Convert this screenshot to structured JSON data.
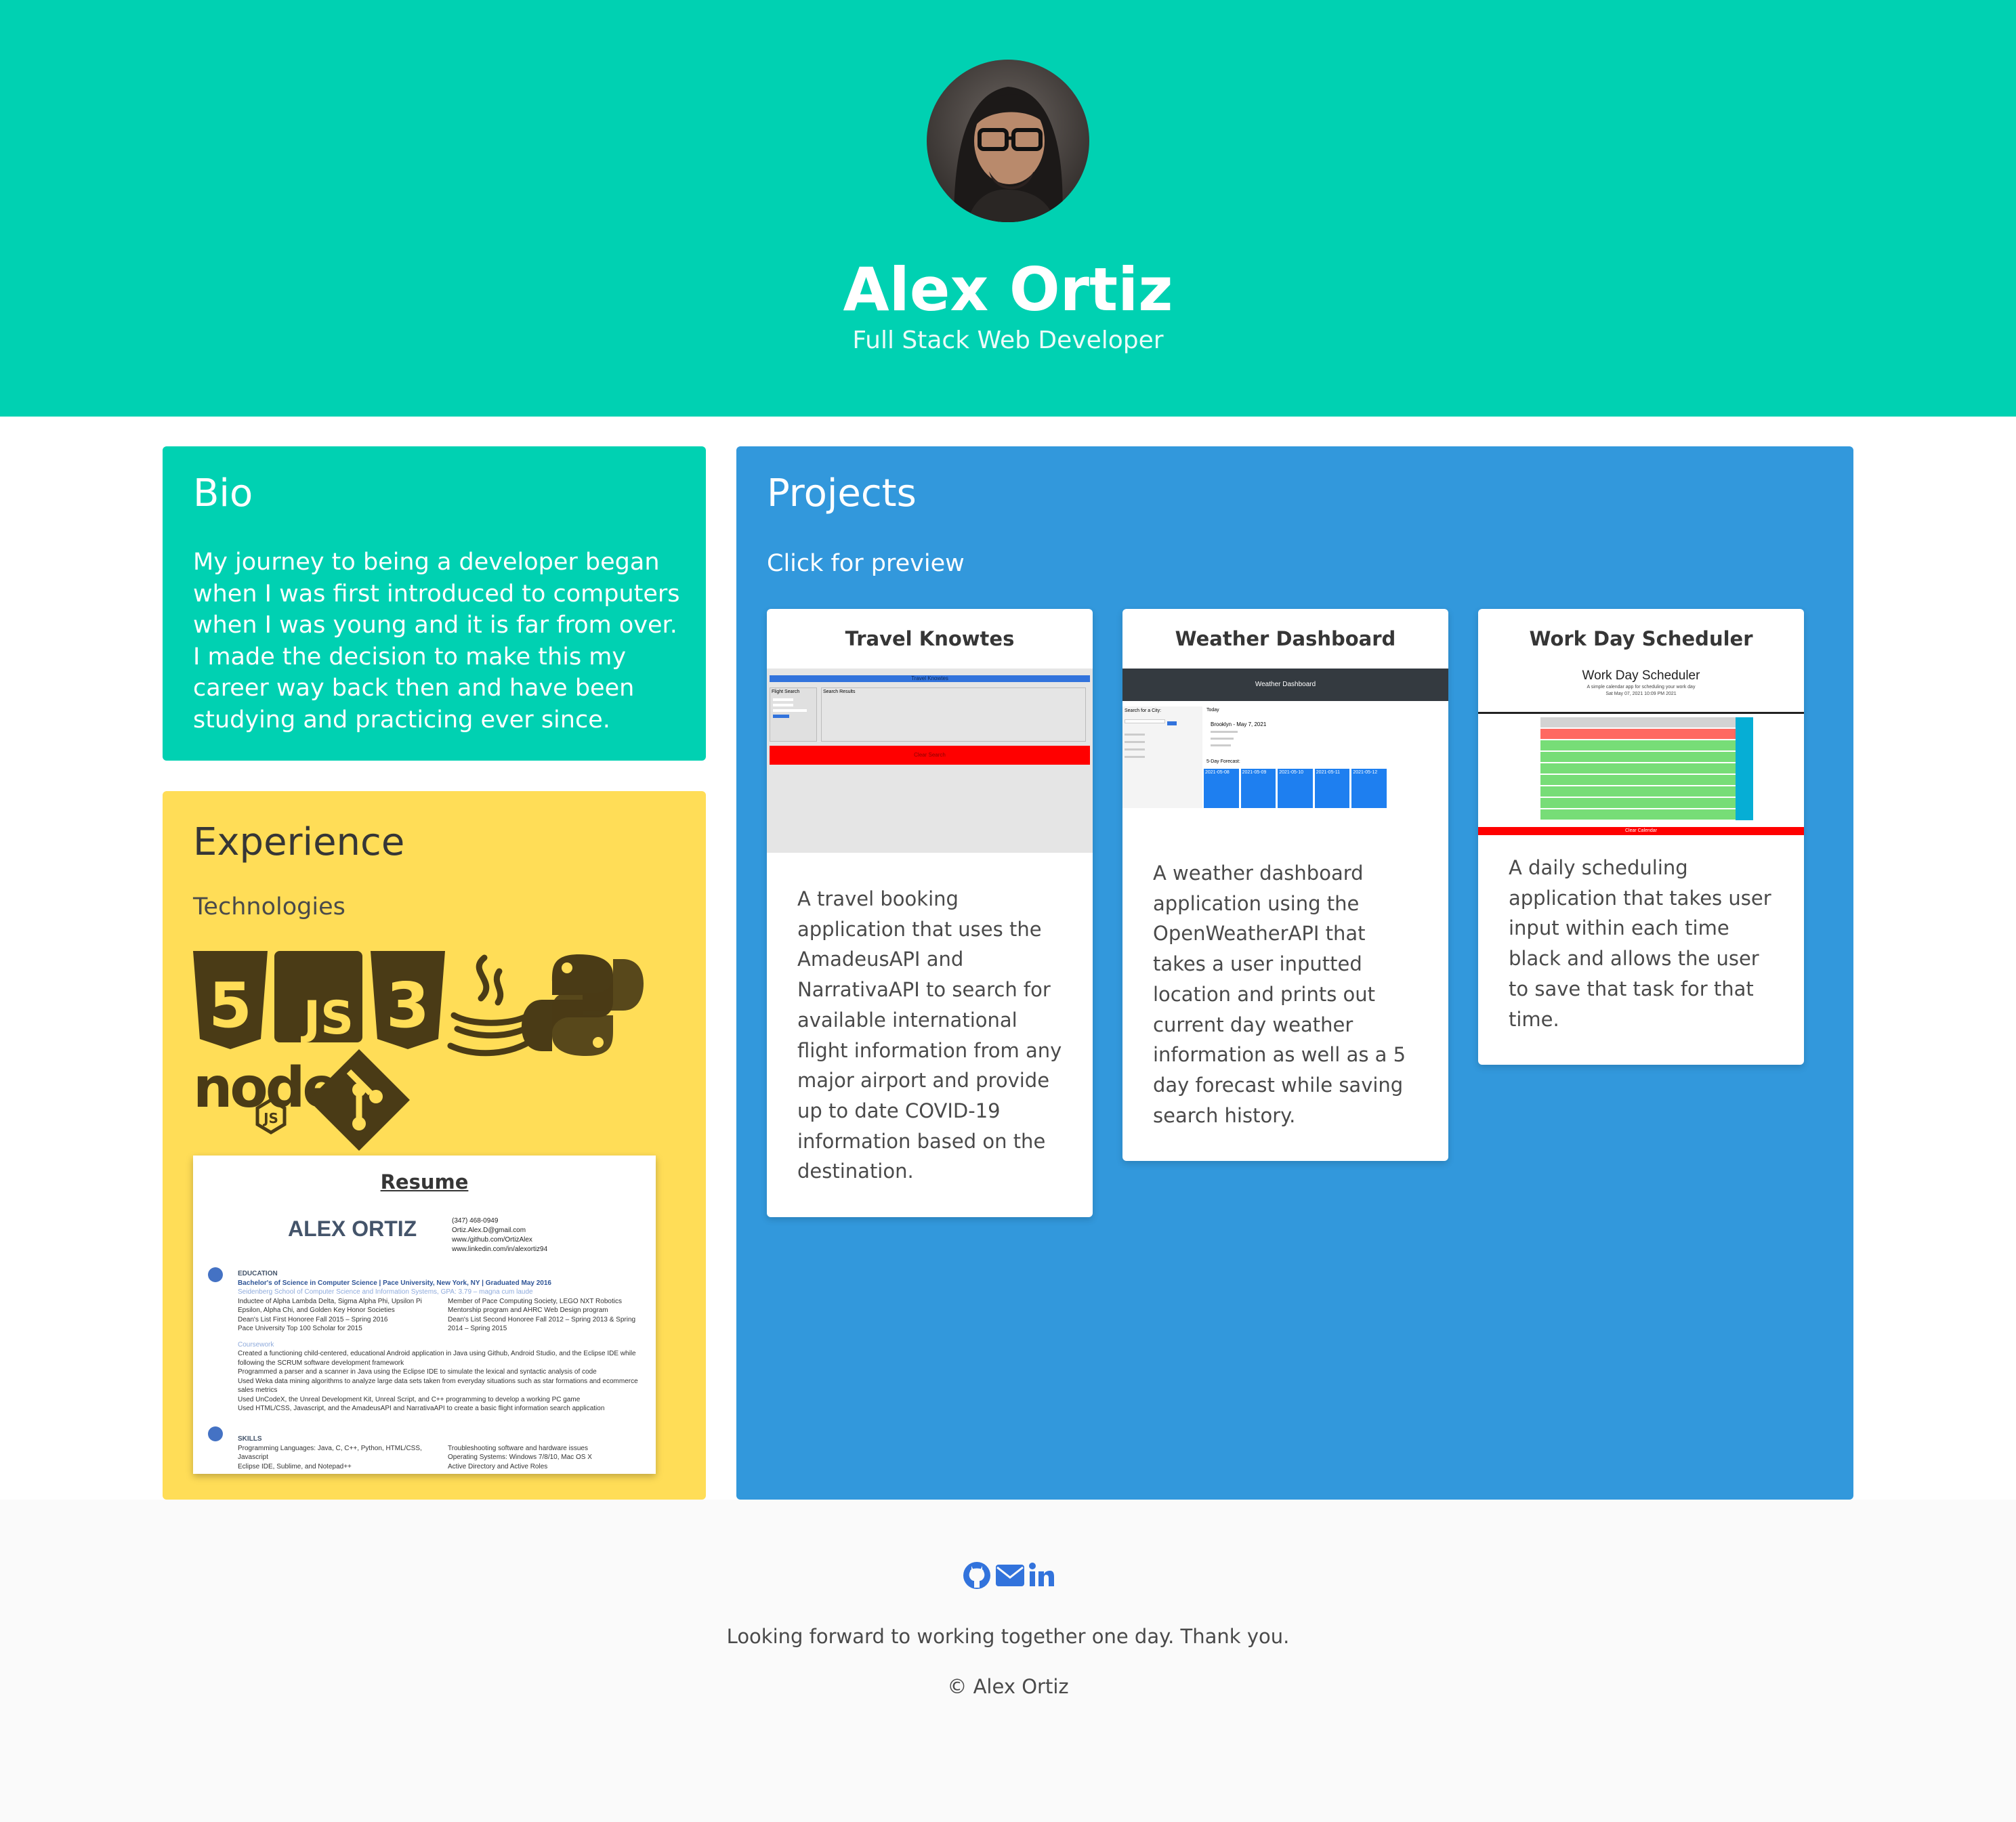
{
  "header": {
    "name": "Alex Ortiz",
    "tagline": "Full Stack Web Developer"
  },
  "bio": {
    "title": "Bio",
    "text": "My journey to being a developer began when I was first introduced to computers when I was young and it is far from over. I made the decision to make this my career way back then and have been studying and practicing ever since."
  },
  "experience": {
    "title": "Experience",
    "subtitle": "Technologies",
    "technologies": [
      "html5-icon",
      "javascript-icon",
      "css3-icon",
      "java-icon",
      "python-icon",
      "nodejs-icon",
      "git-icon"
    ],
    "resume": {
      "title": "Resume",
      "name": "ALEX ORTIZ",
      "contact": [
        "(347) 468-0949",
        "Ortiz.Alex.D@gmail.com",
        "www./github.com/OrtizAlex",
        "www.linkedin.com/in/alexortiz94"
      ],
      "education_heading": "EDUCATION",
      "degree": "Bachelor's of Science in Computer Science | Pace University, New York, NY | Graduated May 2016",
      "school": "Seidenberg School of Computer Science and Information Systems, GPA: 3.79 – magna cum laude",
      "honors_left": [
        "Inductee of Alpha Lambda Delta, Sigma Alpha Phi, Upsilon Pi Epsilon, Alpha Chi, and Golden Key Honor Societies",
        "Dean's List First Honoree Fall 2015 – Spring 2016",
        "Pace University Top 100 Scholar for 2015"
      ],
      "honors_right": [
        "Member of Pace Computing Society, LEGO NXT Robotics Mentorship program and AHRC Web Design program",
        "Dean's List Second Honoree Fall 2012 – Spring 2013 & Spring 2014 – Spring 2015"
      ],
      "coursework_heading": "Coursework",
      "coursework": [
        "Created a functioning child-centered, educational Android application in Java using Github, Android Studio, and the Eclipse IDE while following the SCRUM software development framework",
        "Programmed a parser and a scanner in Java using the Eclipse IDE to simulate the lexical and syntactic analysis of code",
        "Used Weka data mining algorithms to analyze large data sets taken from everyday situations such as star formations and ecommerce sales metrics",
        "Used UnCodeX, the Unreal Development Kit, Unreal Script, and C++ programming to develop a working PC game",
        "Used HTML/CSS, Javascript, and the AmadeusAPI and NarrativaAPI to create a basic flight information search application"
      ],
      "skills_heading": "SKILLS",
      "skills_left": [
        "Programming Languages: Java, C, C++, Python, HTML/CSS, Javascript",
        "Eclipse IDE, Sublime, and Notepad++"
      ],
      "skills_right": [
        "Troubleshooting software and hardware issues",
        "Operating Systems: Windows 7/8/10, Mac OS X",
        "Active Directory and Active Roles"
      ]
    }
  },
  "projects": {
    "title": "Projects",
    "subtitle": "Click for preview",
    "cards": [
      {
        "title": "Travel Knowtes",
        "description": "A travel booking application that uses the AmadeusAPI and NarrativaAPI to search for available international flight information from any major airport and provide up to date COVID-19 information based on the destination.",
        "preview": {
          "banner": "Travel Knowtes",
          "left_label": "Flight Search",
          "right_label": "Search Results",
          "button": "Clear Search"
        }
      },
      {
        "title": "Weather Dashboard",
        "description": "A weather dashboard application using the OpenWeatherAPI that takes a user inputted location and prints out current day weather information as well as a 5 day forecast while saving search history.",
        "preview": {
          "navbar": "Weather Dashboard",
          "search_label": "Search for a City:",
          "today": "Today",
          "city": "Brooklyn - May 7, 2021",
          "forecast_label": "5-Day Forecast:",
          "days": [
            "2021-05-08",
            "2021-05-09",
            "2021-05-10",
            "2021-05-11",
            "2021-05-12"
          ]
        }
      },
      {
        "title": "Work Day Scheduler",
        "description": "A daily scheduling application that takes user input within each time black and allows the user to save that task for that time.",
        "preview": {
          "heading": "Work Day Scheduler",
          "subheading": "A simple calendar app for scheduling your work day",
          "date": "Sat May 07, 2021 10:09 PM 2021",
          "clear": "Clear Calendar"
        }
      }
    ]
  },
  "footer": {
    "social": [
      "github-icon",
      "email-icon",
      "linkedin-icon"
    ],
    "message": "Looking forward to working together one day. Thank you.",
    "copyright": "© Alex Ortiz"
  },
  "colors": {
    "primary": "#00d1b2",
    "warning": "#ffdd57",
    "info": "#3298dc",
    "footer": "#fafafa",
    "social": "#3273dc"
  }
}
